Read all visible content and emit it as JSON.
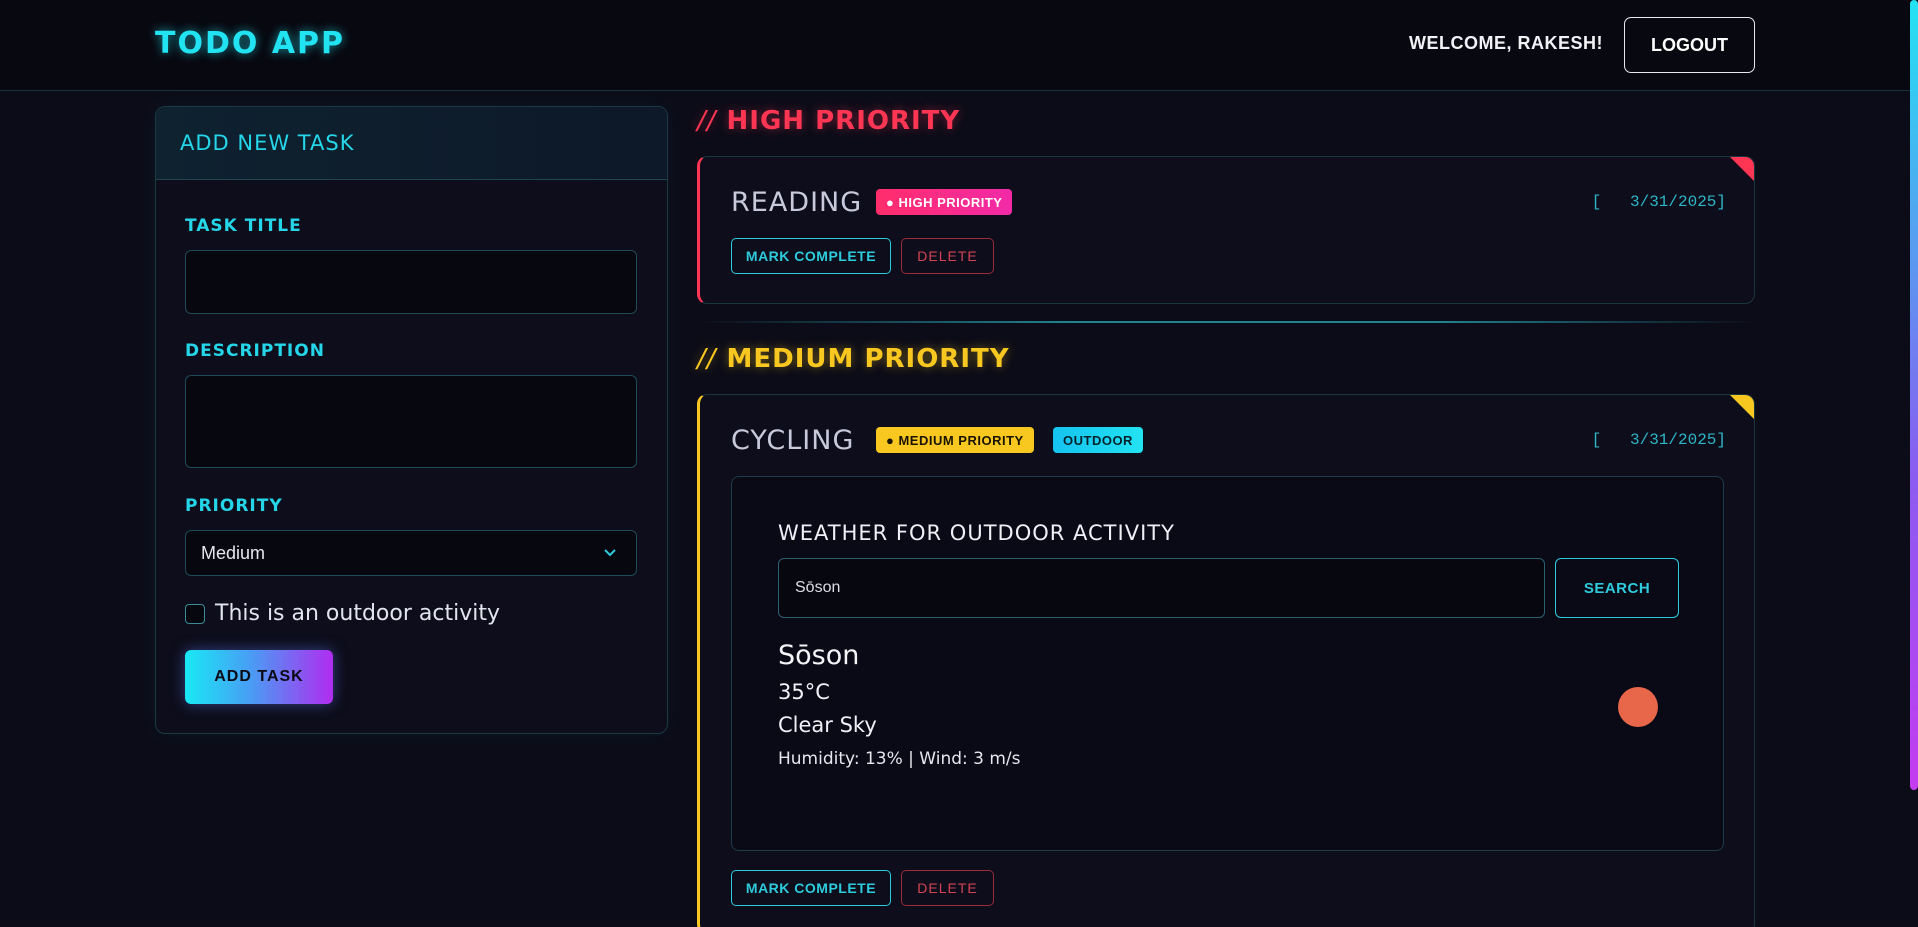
{
  "header": {
    "app_title": "TODO APP",
    "welcome": "WELCOME, RAKESH!",
    "logout_label": "LOGOUT"
  },
  "add_task": {
    "title": "ADD NEW TASK",
    "task_title_label": "TASK TITLE",
    "task_title_value": "",
    "description_label": "DESCRIPTION",
    "description_value": "",
    "priority_label": "PRIORITY",
    "priority_selected": "Medium",
    "outdoor_label": "This is an outdoor activity",
    "outdoor_checked": false,
    "submit_label": "ADD TASK"
  },
  "sections": {
    "high": {
      "slashes": "//",
      "heading": "HIGH PRIORITY",
      "color": "#ff3554",
      "task": {
        "title": "READING",
        "badge": "● HIGH PRIORITY",
        "date": "[   3/31/2025]",
        "complete_label": "MARK COMPLETE",
        "delete_label": "DELETE"
      }
    },
    "medium": {
      "slashes": "//",
      "heading": "MEDIUM PRIORITY",
      "color": "#f9c820",
      "task": {
        "title": "CYCLING",
        "badge": "● MEDIUM PRIORITY",
        "outdoor_badge": "OUTDOOR",
        "date": "[   3/31/2025]",
        "complete_label": "MARK COMPLETE",
        "delete_label": "DELETE",
        "weather": {
          "title": "WEATHER FOR OUTDOOR ACTIVITY",
          "search_value": "Sōson",
          "search_label": "SEARCH",
          "city": "Sōson",
          "temperature": "35°C",
          "condition": "Clear Sky",
          "details": "Humidity: 13% | Wind: 3 m/s",
          "icon": "sun-icon"
        }
      }
    }
  },
  "colors": {
    "accent": "#22e3f2",
    "high": "#ff3554",
    "medium": "#f9c820",
    "background": "#0c0c18"
  }
}
